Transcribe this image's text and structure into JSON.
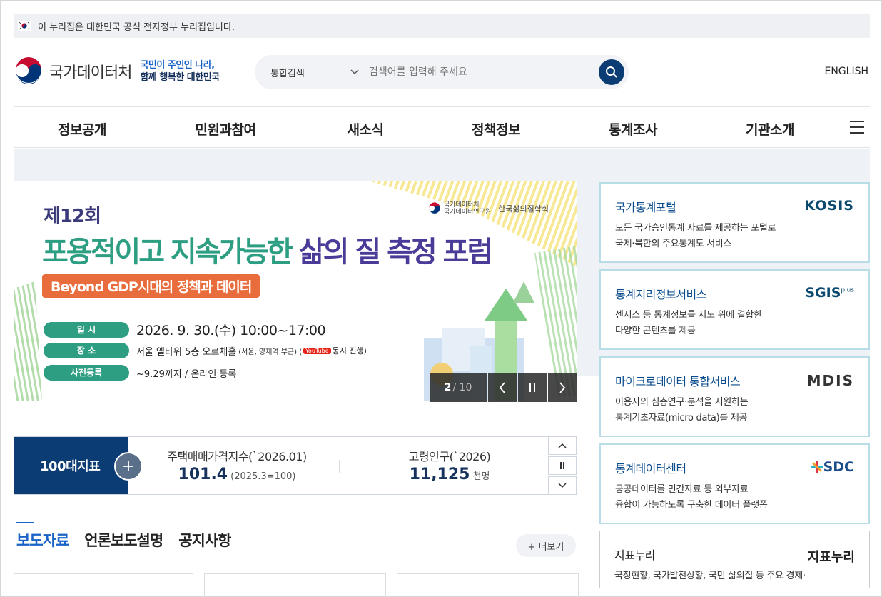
{
  "gov_notice": "이 누리집은 대한민국 공식 전자정부 누리집입니다.",
  "header": {
    "logo_text": "국가데이터처",
    "slogan_line1": "국민이 주인인 나라,",
    "slogan_line2": "함께 행복한 대한민국",
    "search_category": "통합검색",
    "search_placeholder": "검색어를 입력해 주세요",
    "english_label": "ENGLISH"
  },
  "nav": [
    "정보공개",
    "민원과참여",
    "새소식",
    "정책정보",
    "통계조사",
    "기관소개"
  ],
  "banner": {
    "edition": "제12회",
    "title_green": "포용적이고 지속가능한",
    "title_purple": "삶의 질 측정 포럼",
    "subtitle": "Beyond GDP시대의 정책과 데이터",
    "org1a": "국가데이터처",
    "org1b": "국가데이터연구원",
    "org2": "한국삶의질학회",
    "date_label": "일  시",
    "date_value": "2026. 9. 30.(수) 10:00~17:00",
    "place_label": "장  소",
    "place_value": "서울 엘타워 5층 오르체홀",
    "place_detail": "(서울, 양재역 부근) (",
    "youtube": "YouTube",
    "place_live": "동시 진행)",
    "reg_label": "사전등록",
    "reg_value": "~9.29까지 / 온라인 등록",
    "slide_current": "2",
    "slide_total": "/ 10"
  },
  "indicators": {
    "title": "100대지표",
    "items": [
      {
        "label": "주택매매가격지수(`2026.01)",
        "value": "101.4",
        "unit": "(2025.3=100)"
      },
      {
        "label": "고령인구(`2026)",
        "value": "11,125",
        "unit": "천명"
      }
    ]
  },
  "tabs": [
    "보도자료",
    "언론보도설명",
    "공지사항"
  ],
  "more_label": "+ 더보기",
  "services": [
    {
      "title": "국가통계포털",
      "desc1": "모든 국가승인통계 자료를 제공하는 포털로",
      "desc2": "국제·북한의 주요통계도 서비스",
      "logo": "KOSIS"
    },
    {
      "title": "통계지리정보서비스",
      "desc1": "센서스 등 통계정보를 지도 위에 결합한",
      "desc2": "다양한 콘텐츠를 제공",
      "logo": "SGIS",
      "logo_sup": "plus"
    },
    {
      "title": "마이크로데이터 통합서비스",
      "desc1": "이용자의 심층연구·분석을 지원하는",
      "desc2": "통계기초자료(micro data)를 제공",
      "logo": "MDIS"
    },
    {
      "title": "통계데이터센터",
      "desc1": "공공데이터를 민간자료 등 외부자료",
      "desc2": "융합이 가능하도록 구축한 데이터 플랫폼",
      "logo": "SDC"
    },
    {
      "title": "지표누리",
      "desc1": "국정현황, 국가발전상황, 국민 삶의질 등 주요 경제·",
      "desc2": "",
      "logo": "지표누리"
    }
  ],
  "colors": {
    "primary": "#0b3d74",
    "accent_blue": "#1a63c6",
    "green": "#2e9e83",
    "purple": "#4b3b98",
    "orange": "#e96d3c"
  }
}
